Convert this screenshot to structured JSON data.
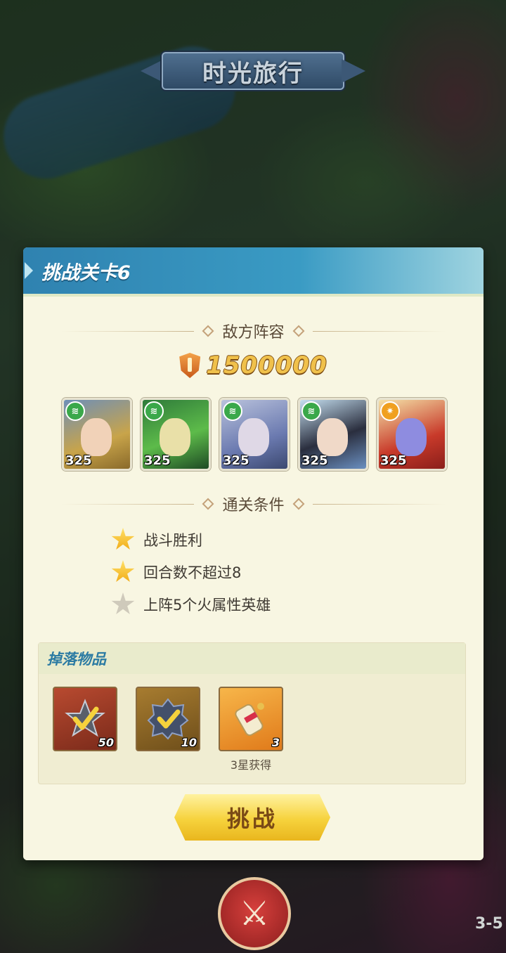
{
  "header": {
    "title": "时光旅行"
  },
  "panel": {
    "title": "挑战关卡6",
    "enemy_section": "敌方阵容",
    "enemy_power": "1500000",
    "heroes": [
      {
        "level": "325",
        "element": "wind"
      },
      {
        "level": "325",
        "element": "wind"
      },
      {
        "level": "325",
        "element": "wind"
      },
      {
        "level": "325",
        "element": "wind"
      },
      {
        "level": "325",
        "element": "light"
      }
    ],
    "conditions_section": "通关条件",
    "conditions": [
      {
        "text": "战斗胜利",
        "achieved": true
      },
      {
        "text": "回合数不超过8",
        "achieved": true
      },
      {
        "text": "上阵5个火属性英雄",
        "achieved": false
      }
    ],
    "drops": {
      "title": "掉落物品",
      "items": [
        {
          "qty": "50",
          "icon": "star-check-icon",
          "note": ""
        },
        {
          "qty": "10",
          "icon": "gear-check-icon",
          "note": ""
        },
        {
          "qty": "3",
          "icon": "scroll-icon",
          "note": "3星获得"
        }
      ]
    },
    "challenge_button": "挑战"
  },
  "scene": {
    "stage_label": "3-5"
  },
  "colors": {
    "accent_blue": "#2f82b0",
    "button_yellow": "#f6d23c",
    "power_gold": "#f0c14b"
  }
}
